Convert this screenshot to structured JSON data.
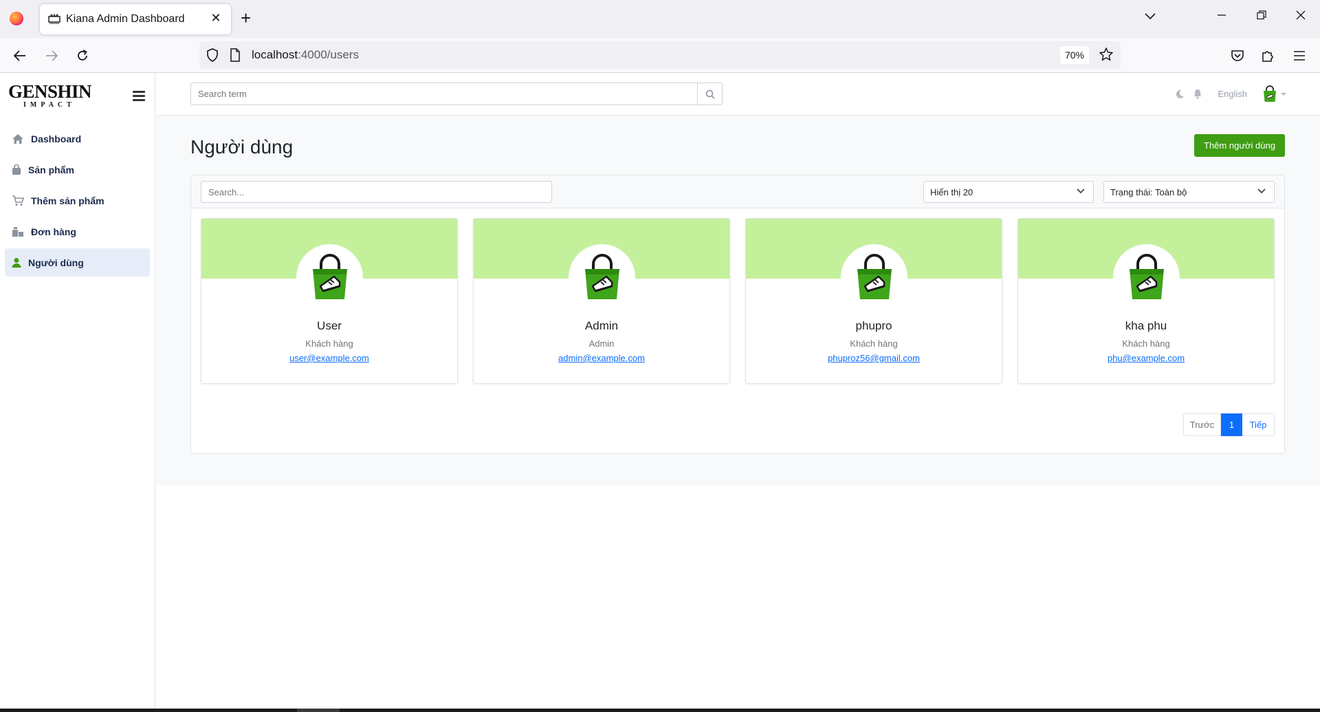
{
  "browser": {
    "tab_title": "Kiana Admin Dashboard",
    "url_host": "localhost",
    "url_path": ":4000/users",
    "zoom": "70%"
  },
  "brand": {
    "name": "GENSHIN",
    "sub": "IMPACT"
  },
  "sidebar": {
    "items": [
      {
        "label": "Dashboard",
        "icon": "home-icon"
      },
      {
        "label": "Sản phẩm",
        "icon": "bag-icon"
      },
      {
        "label": "Thêm sản phẩm",
        "icon": "cart-icon"
      },
      {
        "label": "Đơn hàng",
        "icon": "orders-icon"
      },
      {
        "label": "Người dùng",
        "icon": "user-icon",
        "active": true
      }
    ]
  },
  "topbar": {
    "search_placeholder": "Search term",
    "language": "English"
  },
  "page": {
    "title": "Người dùng",
    "add_button": "Thêm người dùng"
  },
  "filters": {
    "search_placeholder": "Search...",
    "page_size": "Hiển thị 20",
    "status": "Trạng thái: Toàn bộ"
  },
  "users": [
    {
      "name": "User",
      "role": "Khách hàng",
      "email": "user@example.com"
    },
    {
      "name": "Admin",
      "role": "Admin",
      "email": "admin@example.com"
    },
    {
      "name": "phupro",
      "role": "Khách hàng",
      "email": "phuproz56@gmail.com"
    },
    {
      "name": "kha phu",
      "role": "Khách hàng",
      "email": "phu@example.com"
    }
  ],
  "pagination": {
    "prev": "Trước",
    "current": "1",
    "next": "Tiếp"
  },
  "colors": {
    "accent": "#3f9d12",
    "banner": "#c4f09c",
    "link": "#0d6efd"
  }
}
